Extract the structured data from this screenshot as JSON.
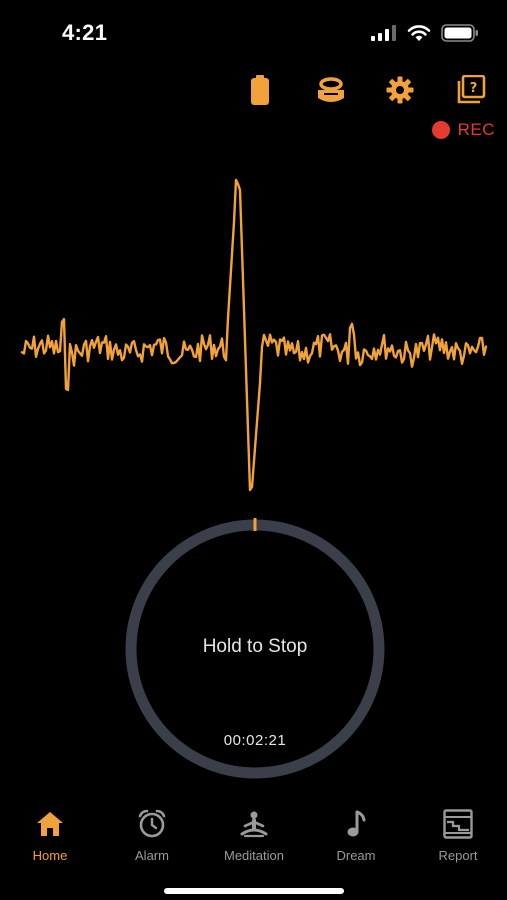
{
  "status_bar": {
    "time": "4:21",
    "icons": [
      "cellular-signal-icon",
      "wifi-icon",
      "battery-icon"
    ]
  },
  "toolbar": {
    "icons": [
      "device-battery-icon",
      "headband-icon",
      "gear-icon",
      "help-cards-icon"
    ]
  },
  "recording": {
    "label": "REC",
    "color": "#e53b30"
  },
  "waveform": {
    "color": "#f2a23a"
  },
  "stop_control": {
    "label": "Hold to Stop",
    "timer": "00:02:21",
    "ring_color": "#3a3f4a",
    "marker_color": "#f2a23a"
  },
  "tabbar": {
    "active_color": "#f2a23a",
    "inactive_color": "#9a9a9a",
    "tabs": [
      {
        "label": "Home",
        "icon": "home-icon",
        "active": true
      },
      {
        "label": "Alarm",
        "icon": "alarm-clock-icon",
        "active": false
      },
      {
        "label": "Meditation",
        "icon": "meditation-icon",
        "active": false
      },
      {
        "label": "Dream",
        "icon": "music-note-icon",
        "active": false
      },
      {
        "label": "Report",
        "icon": "report-icon",
        "active": false
      }
    ]
  }
}
